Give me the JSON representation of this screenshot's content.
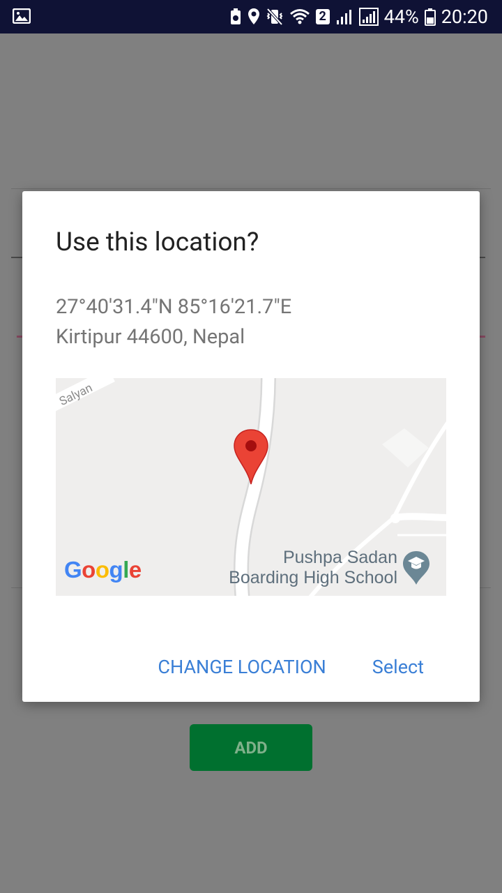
{
  "status_bar": {
    "battery_percent": "44%",
    "time": "20:20",
    "sim_badge": "2",
    "icons": [
      "image-icon",
      "battery-saver-icon",
      "location-icon",
      "vibrate-icon",
      "wifi-icon",
      "signal-icon",
      "signal-icon",
      "battery-icon"
    ]
  },
  "dialog": {
    "title": "Use this location?",
    "coordinates": "27°40'31.4\"N 85°16'21.7\"E",
    "address": "Kirtipur 44600, Nepal",
    "map": {
      "road_label": "Salyan",
      "poi_line1": "Pushpa Sadan",
      "poi_line2": "Boarding High School",
      "logo": "Google"
    },
    "actions": {
      "change_location": "CHANGE LOCATION",
      "select": "Select"
    }
  },
  "background": {
    "add_button_label": "ADD"
  },
  "colors": {
    "accent": "#3a7fd6",
    "marker": "#ea4335",
    "status_bar": "#0f1235"
  }
}
